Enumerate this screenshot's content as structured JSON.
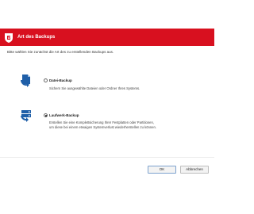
{
  "window": {
    "title": "Art des Backups",
    "brand_color": "#d8101f"
  },
  "instruction": "Bitte wählen Sie zunächst die Art des zu erstellenden Backups aus.",
  "options": [
    {
      "label": "Datei-Backup",
      "selected": false,
      "icon": "file-backup-icon",
      "description": [
        "Sichern Sie ausgewählte Dateien oder Ordner Ihres Systems."
      ]
    },
    {
      "label": "Laufwerk-Backup",
      "selected": true,
      "icon": "drive-backup-icon",
      "description": [
        "Erstellen Sie eine Komplettsicherung Ihrer Festplatten oder Partitionen,",
        "um diese bei einem etwaigen Systemverlust wiederherstellen zu können."
      ]
    }
  ],
  "buttons": {
    "ok": "OK",
    "cancel": "Abbrechen"
  }
}
